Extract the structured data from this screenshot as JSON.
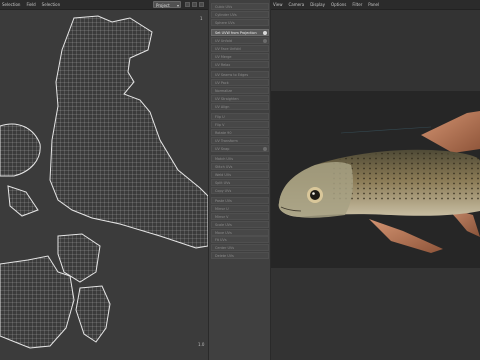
{
  "uv_editor": {
    "menu": [
      "Selection",
      "Field",
      "Selection"
    ],
    "selection_dropdown": "Project",
    "tick_top": "1",
    "tick_bottom": "1.0"
  },
  "operator_panel": {
    "items": [
      {
        "label": "Cubic UVs"
      },
      {
        "label": "Cylinder UVs"
      },
      {
        "label": "Sphere UVs"
      },
      {
        "label": "Set UVW from Projection",
        "active": true
      },
      {
        "label": "UV Unfold"
      },
      {
        "label": "UV Face Unfold"
      },
      {
        "label": "UV Merge"
      },
      {
        "label": "UV Relax"
      },
      {
        "label": "UV Seams to Edges"
      },
      {
        "label": "UV Pack"
      },
      {
        "label": "Normalize"
      },
      {
        "label": "UV Straighten"
      },
      {
        "label": "UV Align"
      },
      {
        "label": "Flip U"
      },
      {
        "label": "Flip V"
      },
      {
        "label": "Rotate 90"
      },
      {
        "label": "UV Transform"
      },
      {
        "label": "UV Snap"
      },
      {
        "label": "Match UVs"
      },
      {
        "label": "Stitch UVs"
      },
      {
        "label": "Weld UVs"
      },
      {
        "label": "Split UVs"
      },
      {
        "label": "Copy UVs"
      },
      {
        "label": "Paste UVs"
      },
      {
        "label": "Mirror U"
      },
      {
        "label": "Mirror V"
      },
      {
        "label": "Scale UVs"
      },
      {
        "label": "Move UVs"
      },
      {
        "label": "Fit UVs"
      },
      {
        "label": "Center UVs"
      },
      {
        "label": "Delete UVs"
      }
    ]
  },
  "viewport": {
    "menu": [
      "View",
      "Camera",
      "Display",
      "Options",
      "Filter",
      "Panel"
    ]
  },
  "colors": {
    "panel_bg": "#404040",
    "uv_bg": "#3b3b3b",
    "render_bg": "#262626",
    "fish_body": "#8a7a55",
    "fish_fin": "#d6845a"
  }
}
